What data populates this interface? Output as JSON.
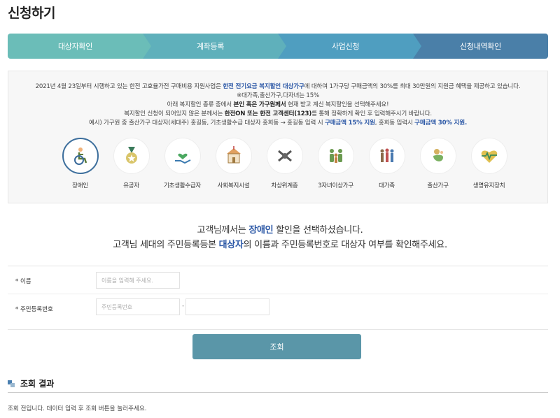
{
  "page": {
    "title": "신청하기"
  },
  "steps": [
    {
      "label": "대상자확인"
    },
    {
      "label": "계좌등록"
    },
    {
      "label": "사업신청"
    },
    {
      "label": "신청내역확인"
    }
  ],
  "info": {
    "line1_pre": "2021년 4월 23일부터 시행하고 있는 한전 고효율가전 구매비용 지원사업은 ",
    "line1_hl": "한전 전기요금 복지할인 대상가구",
    "line1_post": "에 대하여 1가구당 구매금액의 30%를 최대 30만원의 지원금 혜택을 제공하고 있습니다.",
    "line2": "※대가족,출산가구,다자녀는 15%",
    "line3_pre": "아래 복지할인 종류 중에서 ",
    "line3_b": "본인 혹은 가구원께서",
    "line3_post": " 현재 받고 계신 복지할인을 선택해주세요!",
    "line4_pre": "복지할인 신청이 되어있지 않은 분께서는 ",
    "line4_b": "한전ON 또는 한전 고객센터(123)",
    "line4_post": "를 통해 정확하게 확인 후 입력해주시기 바랍니다.",
    "line5_pre": "예시) 가구원 중 출산가구 대상자(세대주) 홍길동, 기초생활수급 대상자 홍희동 → 홍길동 입력 시 ",
    "line5_hl1": "구매금액 15% 지원",
    "line5_mid": ", 홍희동 입력시 ",
    "line5_hl2": "구매금액 30% 지원."
  },
  "categories": [
    {
      "label": "장애인",
      "icon": "wheelchair-icon",
      "active": true
    },
    {
      "label": "유공자",
      "icon": "medal-icon",
      "active": false
    },
    {
      "label": "기초생활수급자",
      "icon": "heart-hand-icon",
      "active": false
    },
    {
      "label": "사회복지시설",
      "icon": "building-icon",
      "active": false
    },
    {
      "label": "차상위계층",
      "icon": "hands-icon",
      "active": false
    },
    {
      "label": "3자녀이상가구",
      "icon": "family-icon",
      "active": false
    },
    {
      "label": "대가족",
      "icon": "big-family-icon",
      "active": false
    },
    {
      "label": "출산가구",
      "icon": "baby-icon",
      "active": false
    },
    {
      "label": "생명유지장치",
      "icon": "heartbeat-icon",
      "active": false
    }
  ],
  "message": {
    "line1_pre": "고객님께서는 ",
    "line1_hl": "장애인",
    "line1_post": " 할인을 선택하셨습니다.",
    "line2_pre": "고객님 세대의 주민등록등본 ",
    "line2_hl": "대상자",
    "line2_post": "의 이름과 주민등록번호로 대상자 여부를 확인해주세요."
  },
  "form": {
    "name_label": "* 이름",
    "name_placeholder": "이름을 입력해 주세요.",
    "rrn_label": "* 주민등록번호",
    "rrn_placeholder": "주민등록번호",
    "rrn_dash": "-"
  },
  "search_button": "조회",
  "result": {
    "title": "조회 결과",
    "text": "조회 전입니다. 데이터 입력 후 조회 버튼을 눌러주세요."
  },
  "colors": {
    "accent": "#2c58a6",
    "button": "#5a96a8"
  }
}
